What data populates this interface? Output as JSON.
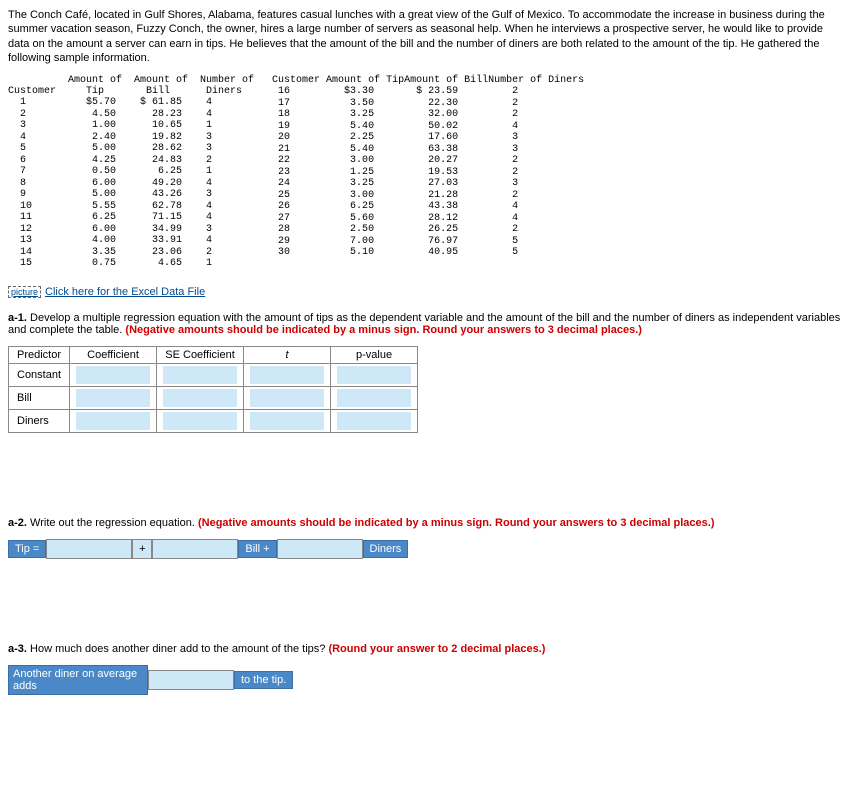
{
  "intro": "The Conch Café, located in Gulf Shores, Alabama, features casual lunches with a great view of the Gulf of Mexico. To accommodate the increase in business during the summer vacation season, Fuzzy Conch, the owner, hires a large number of servers as seasonal help. When he interviews a prospective server, he would like to provide data on the amount a server can earn in tips. He believes that the amount of the bill and the number of diners are both related to the amount of the tip. He gathered the following sample information.",
  "headers": {
    "c": "Customer",
    "tip1": "Amount of",
    "tip2": "Tip",
    "bill1": "Amount of",
    "bill2": "Bill",
    "din1": "Number of",
    "din2": "Diners",
    "r_c": "Customer",
    "r_tip": "Amount of Tip",
    "r_bill": "Amount of Bill",
    "r_din": "Number of Diners"
  },
  "left_rows": [
    {
      "c": "1",
      "t": "$5.70",
      "b": "$ 61.85",
      "d": "4"
    },
    {
      "c": "2",
      "t": "4.50",
      "b": "28.23",
      "d": "4"
    },
    {
      "c": "3",
      "t": "1.00",
      "b": "10.65",
      "d": "1"
    },
    {
      "c": "4",
      "t": "2.40",
      "b": "19.82",
      "d": "3"
    },
    {
      "c": "5",
      "t": "5.00",
      "b": "28.62",
      "d": "3"
    },
    {
      "c": "6",
      "t": "4.25",
      "b": "24.83",
      "d": "2"
    },
    {
      "c": "7",
      "t": "0.50",
      "b": "6.25",
      "d": "1"
    },
    {
      "c": "8",
      "t": "6.00",
      "b": "49.20",
      "d": "4"
    },
    {
      "c": "9",
      "t": "5.00",
      "b": "43.26",
      "d": "3"
    },
    {
      "c": "10",
      "t": "5.55",
      "b": "62.78",
      "d": "4"
    },
    {
      "c": "11",
      "t": "6.25",
      "b": "71.15",
      "d": "4"
    },
    {
      "c": "12",
      "t": "6.00",
      "b": "34.99",
      "d": "3"
    },
    {
      "c": "13",
      "t": "4.00",
      "b": "33.91",
      "d": "4"
    },
    {
      "c": "14",
      "t": "3.35",
      "b": "23.06",
      "d": "2"
    },
    {
      "c": "15",
      "t": "0.75",
      "b": "4.65",
      "d": "1"
    }
  ],
  "right_rows": [
    {
      "c": "16",
      "t": "$3.30",
      "b": "$ 23.59",
      "d": "2"
    },
    {
      "c": "17",
      "t": "3.50",
      "b": "22.30",
      "d": "2"
    },
    {
      "c": "18",
      "t": "3.25",
      "b": "32.00",
      "d": "2"
    },
    {
      "c": "19",
      "t": "5.40",
      "b": "50.02",
      "d": "4"
    },
    {
      "c": "20",
      "t": "2.25",
      "b": "17.60",
      "d": "3"
    },
    {
      "c": "21",
      "t": "5.40",
      "b": "63.38",
      "d": "3"
    },
    {
      "c": "22",
      "t": "3.00",
      "b": "20.27",
      "d": "2"
    },
    {
      "c": "23",
      "t": "1.25",
      "b": "19.53",
      "d": "2"
    },
    {
      "c": "24",
      "t": "3.25",
      "b": "27.03",
      "d": "3"
    },
    {
      "c": "25",
      "t": "3.00",
      "b": "21.28",
      "d": "2"
    },
    {
      "c": "26",
      "t": "6.25",
      "b": "43.38",
      "d": "4"
    },
    {
      "c": "27",
      "t": "5.60",
      "b": "28.12",
      "d": "4"
    },
    {
      "c": "28",
      "t": "2.50",
      "b": "26.25",
      "d": "2"
    },
    {
      "c": "29",
      "t": "7.00",
      "b": "76.97",
      "d": "5"
    },
    {
      "c": "30",
      "t": "5.10",
      "b": "40.95",
      "d": "5"
    }
  ],
  "excel_link_icon": "picture",
  "excel_link": "Click here for the Excel Data File",
  "a1": {
    "num": "a-1.",
    "text": " Develop a multiple regression equation with the amount of tips as the dependent variable and the amount of the bill and the number of diners as independent variables and complete the table. ",
    "red": "(Negative amounts should be indicated by a minus sign. Round your answers to 3 decimal places.)",
    "th_predictor": "Predictor",
    "th_coef": "Coefficient",
    "th_se": "SE Coefficient",
    "th_t": "t",
    "th_p": "p-value",
    "row_const": "Constant",
    "row_bill": "Bill",
    "row_diners": "Diners"
  },
  "a2": {
    "num": "a-2.",
    "text": " Write out the regression equation. ",
    "red": "(Negative amounts should be indicated by a minus sign. Round your answers to 3 decimal places.)",
    "tip_label": "Tip =",
    "plus": "+",
    "bill_label": "Bill +",
    "diners_label": "Diners"
  },
  "a3": {
    "num": "a-3.",
    "text": " How much does another diner add to the amount of the tips? ",
    "red": "(Round your answer to 2 decimal places.)",
    "left_label": "Another diner on average adds",
    "right_label": "to the tip."
  }
}
